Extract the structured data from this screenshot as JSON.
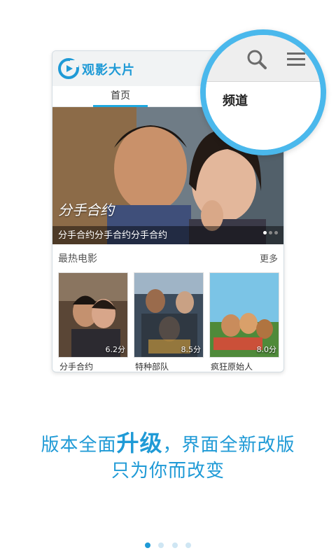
{
  "app": {
    "title": "观影大片"
  },
  "tabs": {
    "home": "首页"
  },
  "banner": {
    "art_title": "分手合约",
    "caption": "分手合约分手合约分手合约",
    "page_count": 3,
    "active_page": 1
  },
  "hot": {
    "title": "最热电影",
    "more": "更多",
    "movies": [
      {
        "name": "分手合约",
        "score": "6.2分"
      },
      {
        "name": "特种部队",
        "score": "8.5分"
      },
      {
        "name": "疯狂原始人",
        "score": "8.0分"
      }
    ]
  },
  "magnifier": {
    "channel_label": "频道",
    "icons": [
      "search-icon",
      "menu-icon"
    ]
  },
  "slogan": {
    "line1_pre": "版本全面",
    "line1_em": "升级",
    "line1_post": "，界面全新改版",
    "line2": "只为你而改变"
  },
  "pager": {
    "count": 4,
    "active": 1
  },
  "colors": {
    "accent": "#1f9ad6",
    "ring": "#4ab8ec"
  }
}
